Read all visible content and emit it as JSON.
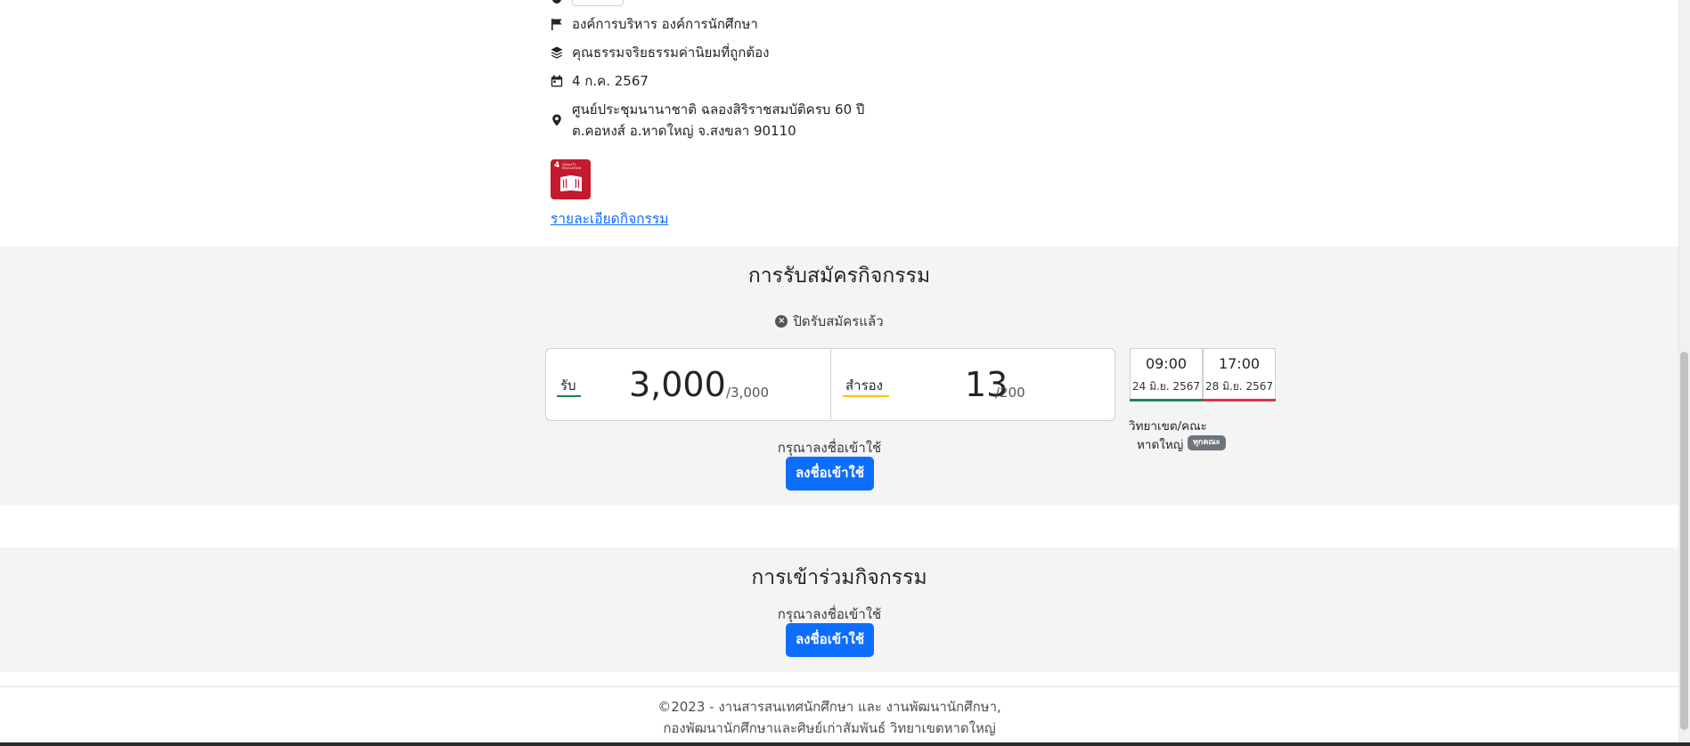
{
  "activity": {
    "organizer": "องค์การบริหาร องค์การนักศึกษา",
    "category": "คุณธรรมจริยธรรมค่านิยมที่ถูกต้อง",
    "date": "4 ก.ค. 2567",
    "location_line1": "ศูนย์ประชุมนานาชาติ ฉลองสิริราชสมบัติครบ 60 ปี",
    "location_line2": "ต.คอหงส์ อ.หาดใหญ่ จ.สงขลา 90110",
    "sdg_number": "4",
    "sdg_text": "QUALITY EDUCATION",
    "detail_link": "รายละเอียดกิจกรรม"
  },
  "registration": {
    "title": "การรับสมัครกิจกรรม",
    "status": "ปิดรับสมัครแล้ว",
    "accepted_label": "รับ",
    "accepted_count": "3,000",
    "accepted_total": "/3,000",
    "reserve_label": "สำรอง",
    "reserve_count": "13",
    "reserve_total": "/200",
    "open_time": "09:00",
    "open_date": "24 มิ.ย. 2567",
    "close_time": "17:00",
    "close_date": "28 มิ.ย. 2567",
    "campus_label": "วิทยาเขต/คณะ",
    "campus_name": "หาดใหญ่",
    "campus_badge": "ทุกคณะ",
    "login_hint": "กรุณาลงชื่อเข้าใช้",
    "login_button": "ลงชื่อเข้าใช้"
  },
  "participation": {
    "title": "การเข้าร่วมกิจกรรม",
    "login_hint": "กรุณาลงชื่อเข้าใช้",
    "login_button": "ลงชื่อเข้าใช้"
  },
  "footer": {
    "line1": "©2023 - งานสารสนเทศนักศึกษา และ งานพัฒนานักศึกษา,",
    "line2": "กองพัฒนานักศึกษาและศิษย์เก่าสัมพันธ์ วิทยาเขตหาดใหญ่"
  },
  "colors": {
    "accepted_underline": "#198754",
    "reserve_underline": "#ffc107",
    "open_bar": "#198754",
    "close_bar": "#dc3545",
    "primary": "#0d6efd",
    "sdg": "#c5192d"
  }
}
